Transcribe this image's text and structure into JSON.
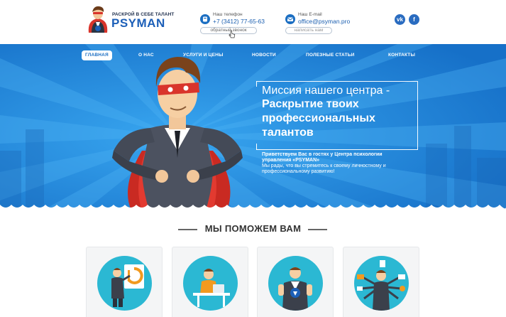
{
  "header": {
    "logo": {
      "tagline": "РАСКРОЙ В СЕБЕ ТАЛАНТ",
      "name": "PSYMAN"
    },
    "phone": {
      "label": "Наш телефон",
      "value": "+7 (3412) 77-65-63",
      "button": "обратный звонок",
      "icon": "phone-icon"
    },
    "email": {
      "label": "Наш E-mail",
      "value": "office@psyman.pro",
      "button": "написать нам",
      "icon": "mail-icon"
    },
    "social": {
      "vk": "vk",
      "fb": "f"
    }
  },
  "nav": {
    "items": [
      {
        "label": "ГЛАВНАЯ",
        "active": true
      },
      {
        "label": "О НАС"
      },
      {
        "label": "УСЛУГИ И ЦЕНЫ"
      },
      {
        "label": "НОВОСТИ"
      },
      {
        "label": "ПОЛЕЗНЫЕ СТАТЬИ"
      },
      {
        "label": "КОНТАКТЫ"
      }
    ]
  },
  "hero": {
    "mission_line1": "Миссия нашего центра -",
    "mission_line2": "Раскрытие твоих",
    "mission_line3": "профессиональных",
    "mission_line4": "талантов",
    "greeting": "Приветствуем Вас в гостях у Центра психологии управления «PSYMAN»",
    "greeting_sub": "Мы рады, что вы стремитесь к своему личностному и профессиональному развитию!"
  },
  "services": {
    "title": "МЫ ПОМОЖЕМ ВАМ"
  },
  "colors": {
    "brand_blue": "#1c5fb8",
    "hero_blue": "#1f86dc",
    "card_teal": "#2bb8d3",
    "cape_red": "#d9342b"
  }
}
